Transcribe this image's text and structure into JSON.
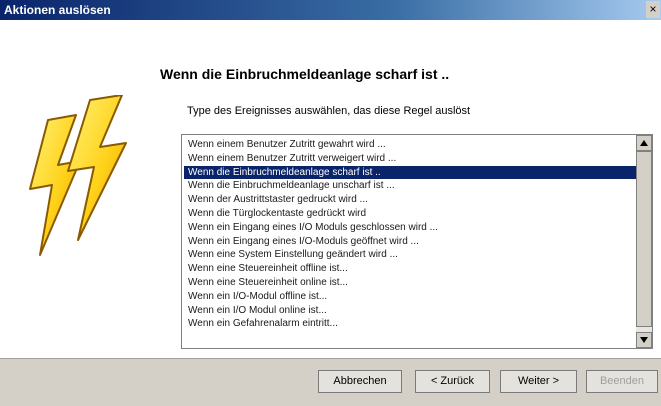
{
  "window": {
    "title": "Aktionen auslösen",
    "close_label": "×"
  },
  "heading": "Wenn die Einbruchmeldeanlage scharf ist ..",
  "instruction": "Type des Ereignisses auswählen, das diese Regel auslöst",
  "event_list": {
    "items": [
      "Wenn einem Benutzer Zutritt gewahrt wird ...",
      "Wenn einem Benutzer Zutritt verweigert wird ...",
      "Wenn die Einbruchmeldeanlage scharf ist ..",
      "Wenn die Einbruchmeldeanlage unscharf ist ...",
      "Wenn der Austrittstaster gedruckt wird ...",
      "Wenn die Türglockentaste gedrückt wird",
      "Wenn ein Eingang eines I/O Moduls geschlossen wird ...",
      "Wenn ein Eingang eines I/O-Moduls geöffnet wird ...",
      "Wenn eine System Einstellung geändert wird ...",
      "Wenn eine Steuereinheit offline ist...",
      "Wenn eine Steuereinheit online ist...",
      "Wenn ein I/O-Modul offline ist...",
      "Wenn ein I/O Modul online ist...",
      "Wenn ein Gefahrenalarm eintritt..."
    ],
    "selected": "Wenn die Einbruchmeldeanlage scharf ist .."
  },
  "buttons": {
    "cancel": "Abbrechen",
    "back": "< Zurück",
    "next": "Weiter >",
    "finish": "Beenden"
  },
  "colors": {
    "selection": "#0a246a",
    "bolt_fill": "#ffd21a",
    "bolt_outline": "#8a5a00"
  },
  "icons": {
    "art": "lightning-bolts-icon",
    "scroll_up": "scroll-up-arrow-icon",
    "scroll_down": "scroll-down-arrow-icon"
  }
}
